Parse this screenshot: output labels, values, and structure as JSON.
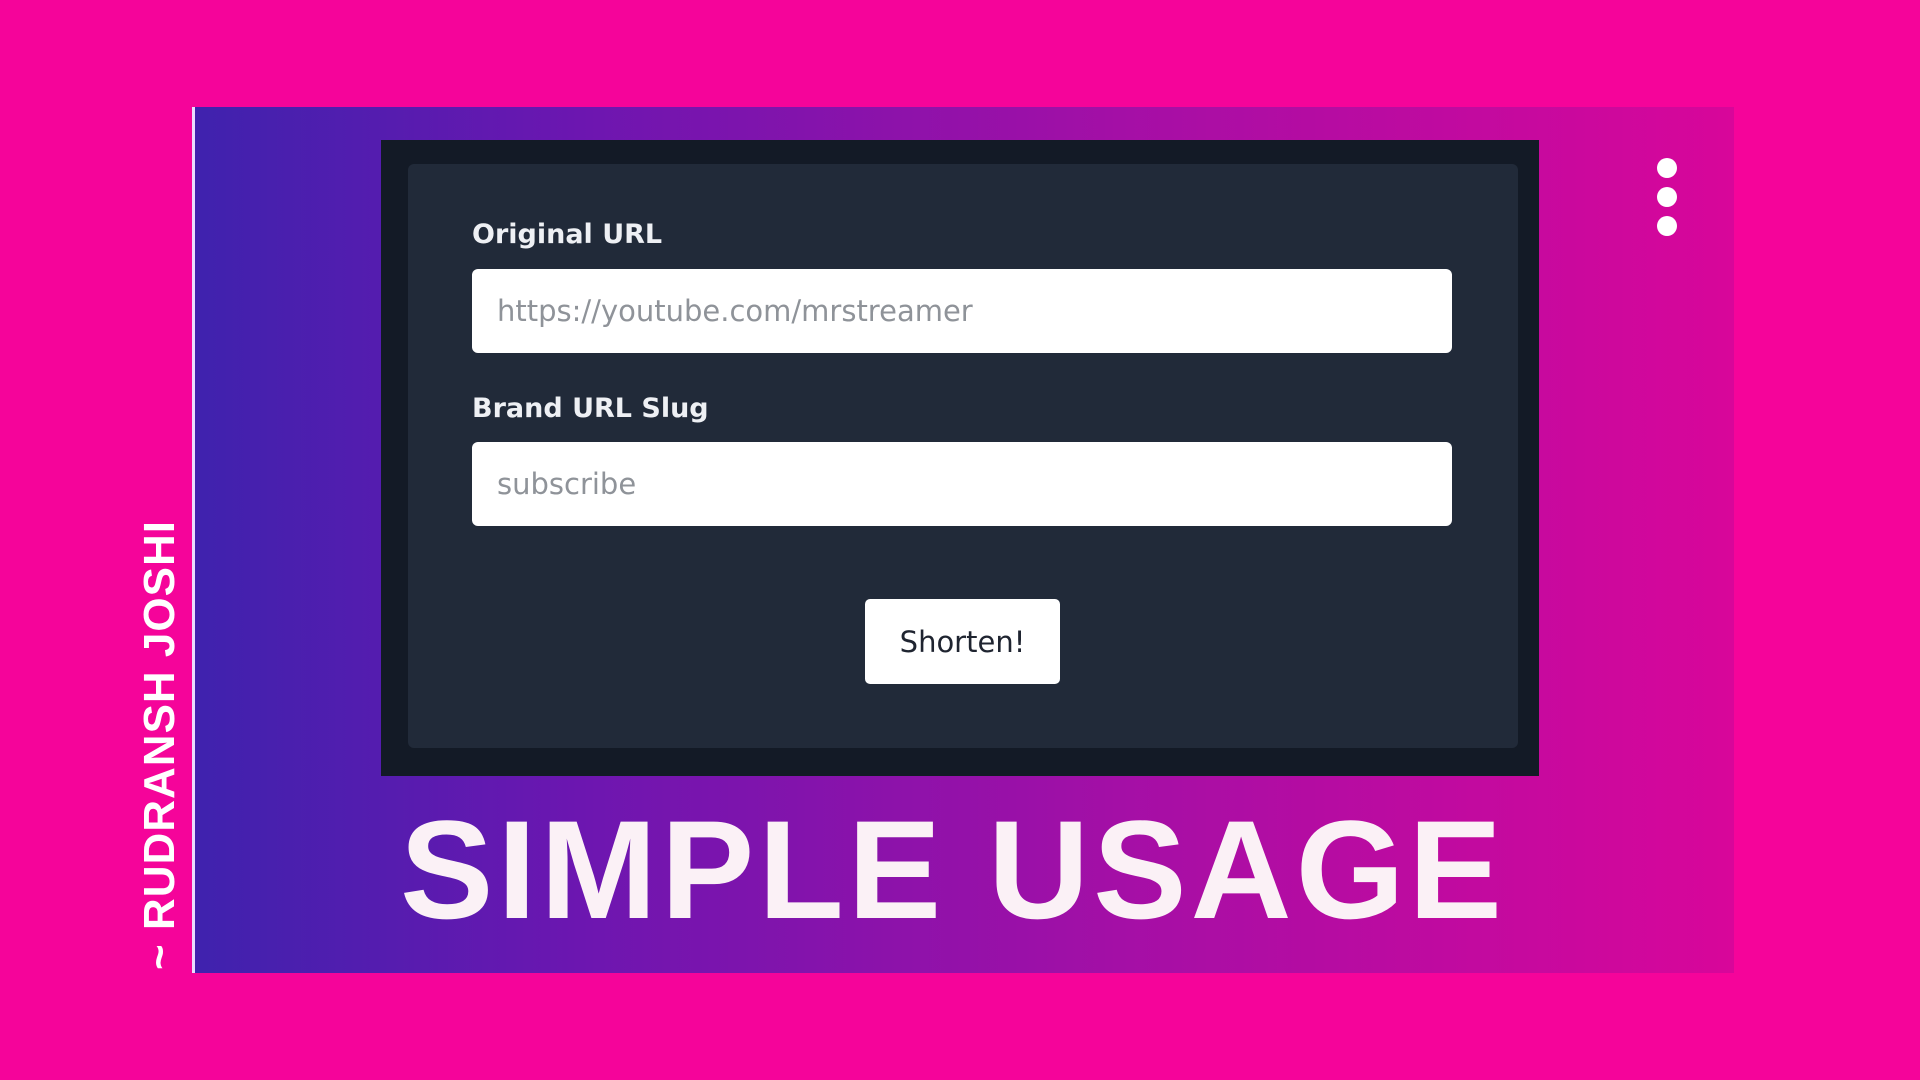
{
  "colors": {
    "background": "#f5049a",
    "panel_gradient_start": "#3f22ae",
    "panel_gradient_end": "#d8069a",
    "card": "#212a39",
    "frame": "#131a26"
  },
  "author": "~ RUDRANSH JOSHI",
  "menu": {
    "icon": "kebab-vertical-icon"
  },
  "form": {
    "original_url_label": "Original URL",
    "original_url_placeholder": "https://youtube.com/mrstreamer",
    "original_url_value": "",
    "slug_label": "Brand URL Slug",
    "slug_placeholder": "subscribe",
    "slug_value": "",
    "submit_label": "Shorten!"
  },
  "headline": "SIMPLE USAGE"
}
